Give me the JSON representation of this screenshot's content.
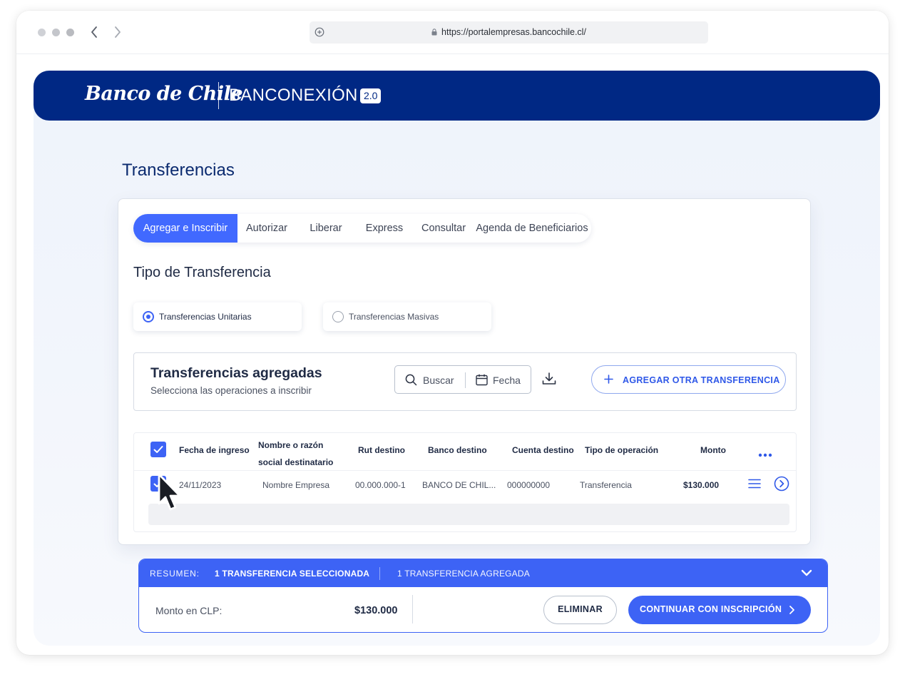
{
  "browser": {
    "url": "https://portalempresas.bancochile.cl/"
  },
  "header": {
    "logo": "Banco de Chile",
    "brand": "BANCONEXIÓN",
    "version": "2.0"
  },
  "page": {
    "title": "Transferencias"
  },
  "tabs": [
    "Agregar e Inscribir",
    "Autorizar",
    "Liberar",
    "Express",
    "Consultar",
    "Agenda de Beneficiarios"
  ],
  "transfer_type": {
    "title": "Tipo de Transferencia",
    "options": [
      "Transferencias Unitarias",
      "Transferencias Masivas"
    ],
    "selected": "Transferencias Unitarias"
  },
  "added": {
    "title": "Transferencias agregadas",
    "subtitle": "Selecciona las operaciones a inscribir",
    "search_label": "Buscar",
    "date_label": "Fecha",
    "add_button": "AGREGAR  OTRA TRANSFERENCIA"
  },
  "table": {
    "headers": {
      "fecha": "Fecha de ingreso",
      "nombre_1": "Nombre o razón",
      "nombre_2": "social destinatario",
      "rut": "Rut destino",
      "banco": "Banco destino",
      "cuenta": "Cuenta destino",
      "tipo": "Tipo de operación",
      "monto": "Monto"
    },
    "rows": [
      {
        "fecha": "24/11/2023",
        "nombre": "Nombre Empresa",
        "rut": "00.000.000-1",
        "banco": "BANCO DE CHIL...",
        "cuenta": "000000000",
        "tipo": "Transferencia",
        "monto": "$130.000"
      }
    ]
  },
  "summary": {
    "label": "RESUMEN:",
    "selected": "1 TRANSFERENCIA SELECCIONADA",
    "added": "1 TRANSFERENCIA AGREGADA",
    "monto_label": "Monto en CLP:",
    "monto_value": "$130.000",
    "delete_button": "ELIMINAR",
    "continue_button": "CONTINUAR CON INSCRIPCIÓN"
  },
  "colors": {
    "brand_navy": "#002884",
    "accent_blue": "#3d63f5",
    "tab_active": "#4169ff"
  }
}
